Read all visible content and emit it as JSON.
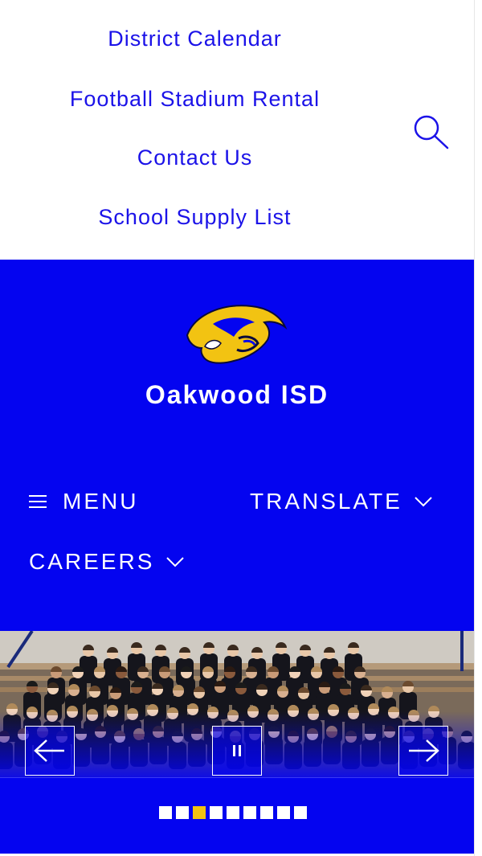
{
  "top_links": [
    {
      "label": "District Calendar"
    },
    {
      "label": "Football Stadium Rental"
    },
    {
      "label": "Contact Us"
    },
    {
      "label": "School Supply List"
    }
  ],
  "search": {
    "icon": "search-icon"
  },
  "header": {
    "logo_icon": "panther-logo-icon",
    "site_title": "Oakwood ISD",
    "menu_label": "MENU",
    "translate_label": "TRANSLATE",
    "careers_label": "CAREERS"
  },
  "slideshow": {
    "prev_icon": "arrow-left-icon",
    "pause_icon": "pause-icon",
    "next_icon": "arrow-right-icon",
    "slide_count": 9,
    "active_slide": 3
  },
  "colors": {
    "brand_blue": "#0404f0",
    "link_blue": "#1b12e8",
    "accent_gold": "#f2c312",
    "white": "#ffffff"
  }
}
